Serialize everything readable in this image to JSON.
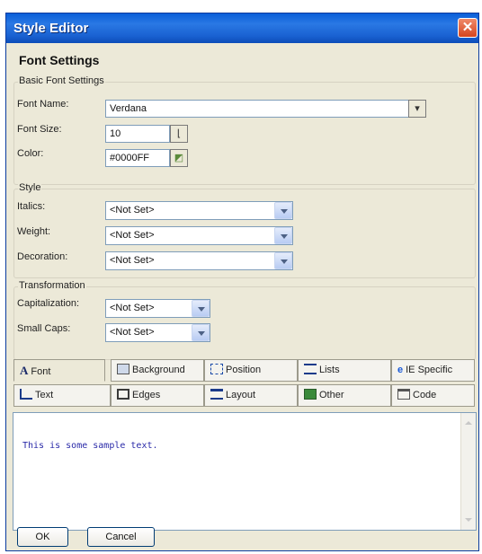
{
  "window": {
    "title": "Style Editor"
  },
  "section_title": "Font Settings",
  "basic": {
    "legend": "Basic Font Settings",
    "font_name_label": "Font Name:",
    "font_name_value": "Verdana",
    "font_size_label": "Font Size:",
    "font_size_value": "10",
    "color_label": "Color:",
    "color_value": "#0000FF"
  },
  "style": {
    "legend": "Style",
    "italics_label": "Italics:",
    "italics_value": "<Not Set>",
    "weight_label": "Weight:",
    "weight_value": "<Not Set>",
    "decoration_label": "Decoration:",
    "decoration_value": "<Not Set>"
  },
  "transformation": {
    "legend": "Transformation",
    "capitalization_label": "Capitalization:",
    "capitalization_value": "<Not Set>",
    "smallcaps_label": "Small Caps:",
    "smallcaps_value": "<Not Set>"
  },
  "tabs_row1": [
    "Font",
    "Background",
    "Position",
    "Lists",
    "IE Specific"
  ],
  "tabs_row2": [
    "Text",
    "Edges",
    "Layout",
    "Other",
    "Code"
  ],
  "active_tab": "Font",
  "preview_text": "This is some sample text.",
  "buttons": {
    "ok": "OK",
    "cancel": "Cancel"
  },
  "colors": {
    "title_bar": "#1a62d2",
    "dialog_bg": "#ece9d8",
    "sample_text": "#2a2aa8"
  }
}
